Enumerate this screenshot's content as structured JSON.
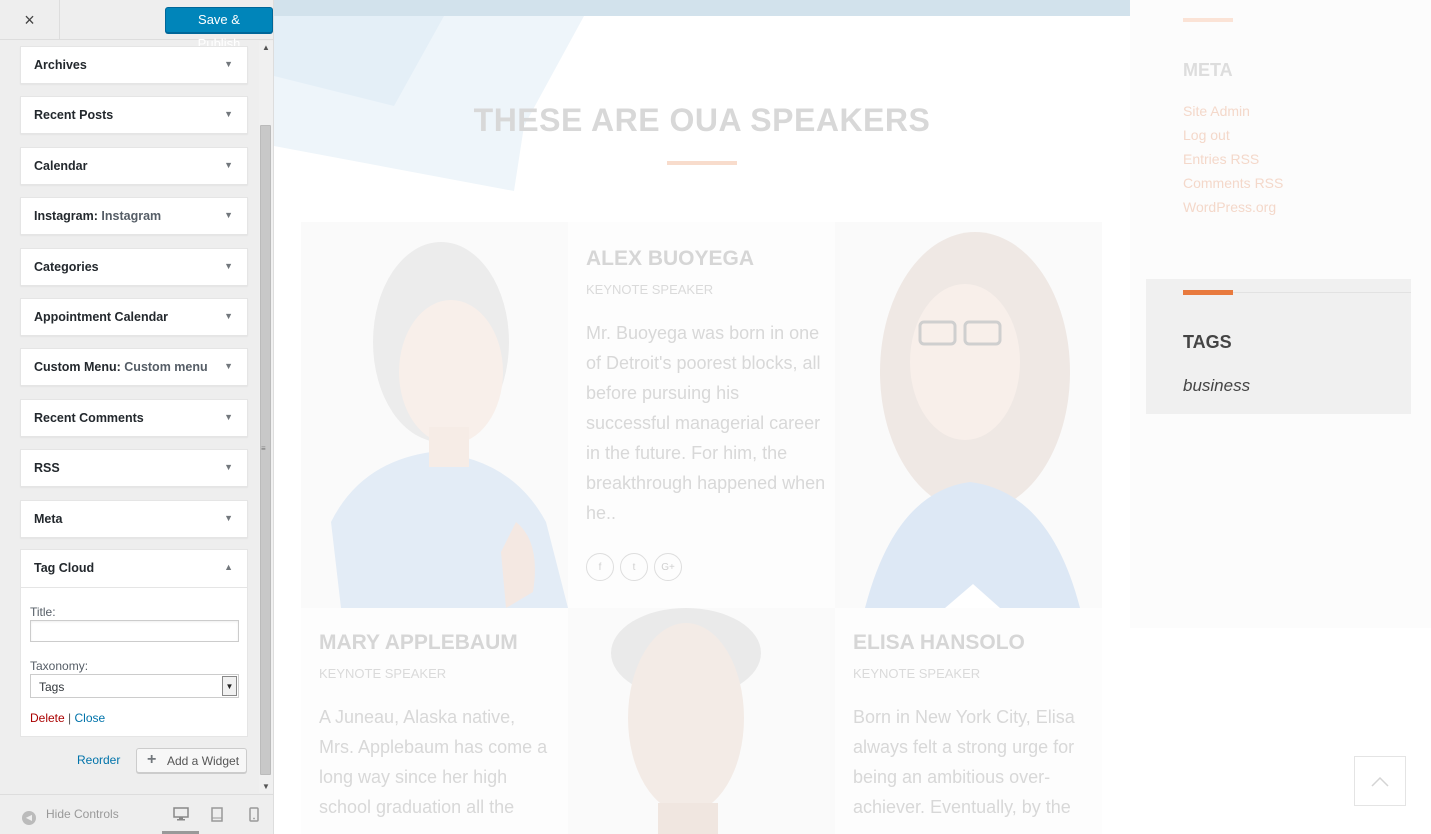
{
  "customizer": {
    "close_label": "×",
    "publish_label": "Save & Publish",
    "widgets": [
      {
        "title": "Archives",
        "subtitle": ""
      },
      {
        "title": "Recent Posts",
        "subtitle": ""
      },
      {
        "title": "Calendar",
        "subtitle": ""
      },
      {
        "title": "Instagram",
        "subtitle": "Instagram"
      },
      {
        "title": "Categories",
        "subtitle": ""
      },
      {
        "title": "Appointment Calendar",
        "subtitle": ""
      },
      {
        "title": "Custom Menu",
        "subtitle": "Custom menu"
      },
      {
        "title": "Recent Comments",
        "subtitle": ""
      },
      {
        "title": "RSS",
        "subtitle": ""
      },
      {
        "title": "Meta",
        "subtitle": ""
      }
    ],
    "widget_sep": ": ",
    "tag_cloud": {
      "title": "Tag Cloud",
      "title_field_label": "Title:",
      "title_value": "",
      "taxonomy_label": "Taxonomy:",
      "taxonomy_value": "Tags",
      "delete_label": "Delete",
      "link_sep": "|",
      "close_label": "Close"
    },
    "reorder_label": "Reorder",
    "add_widget_label": "Add a Widget",
    "hide_controls_label": "Hide Controls",
    "active_device": "desktop"
  },
  "preview": {
    "section_title": "THESE ARE OUA SPEAKERS",
    "speakers": [
      {
        "name": "ALEX BUOYEGA",
        "role": "KEYNOTE SPEAKER",
        "bio": "Mr. Buoyega was born in one of Detroit's poorest blocks, all before pursuing his successful managerial career in the future. For him, the breakthrough happened when he..",
        "social": [
          "f",
          "t",
          "G+"
        ]
      },
      {
        "name": "MARY APPLEBAUM",
        "role": "KEYNOTE SPEAKER",
        "bio": "A Juneau, Alaska native, Mrs. Applebaum has come a long way since her high school graduation all the"
      },
      {
        "name": "ELISA HANSOLO",
        "role": "KEYNOTE SPEAKER",
        "bio": "Born in New York City, Elisa always felt a strong urge for being an ambitious over-achiever. Eventually, by the"
      }
    ],
    "sidebar": {
      "meta_title": "META",
      "meta_links": [
        "Site Admin",
        "Log out",
        "Entries RSS",
        "Comments RSS",
        "WordPress.org"
      ],
      "tags_title": "TAGS",
      "tags": [
        "business"
      ]
    }
  },
  "colors": {
    "publish_blue": "#0085ba",
    "accent_orange": "#e87a3e",
    "delete_red": "#aa0000",
    "link_blue": "#0073aa"
  }
}
